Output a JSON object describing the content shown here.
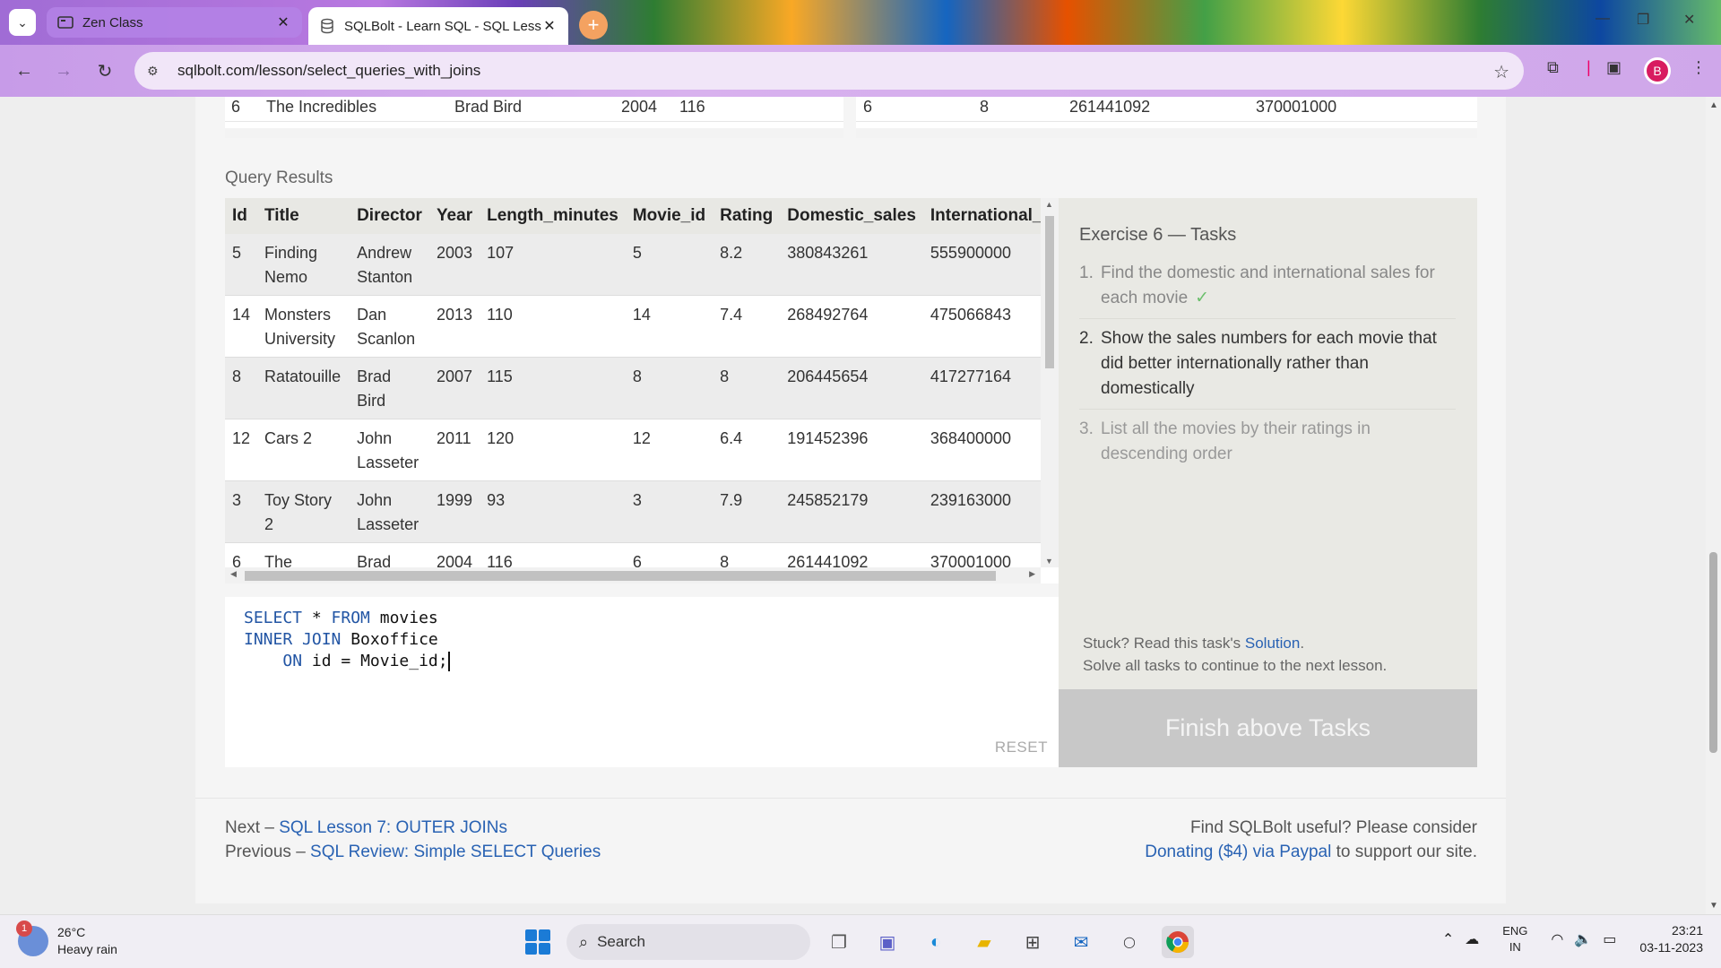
{
  "browser": {
    "tabs": [
      {
        "title": "Zen Class",
        "icon": "zen-class-icon"
      },
      {
        "title": "SQLBolt - Learn SQL - SQL Less",
        "icon": "database-icon"
      }
    ],
    "url": "sqlbolt.com/lesson/select_queries_with_joins",
    "profile_initial": "B",
    "accent": "#b57ee6"
  },
  "partial_tables": {
    "movies_row": [
      "6",
      "The Incredibles",
      "Brad Bird",
      "2004",
      "116"
    ],
    "boxoffice_row": [
      "6",
      "8",
      "261441092",
      "370001000"
    ]
  },
  "query_results": {
    "label": "Query Results",
    "columns": [
      "Id",
      "Title",
      "Director",
      "Year",
      "Length_minutes",
      "Movie_id",
      "Rating",
      "Domestic_sales",
      "International_sa"
    ],
    "rows": [
      [
        "5",
        "Finding Nemo",
        "Andrew Stanton",
        "2003",
        "107",
        "5",
        "8.2",
        "380843261",
        "555900000"
      ],
      [
        "14",
        "Monsters University",
        "Dan Scanlon",
        "2013",
        "110",
        "14",
        "7.4",
        "268492764",
        "475066843"
      ],
      [
        "8",
        "Ratatouille",
        "Brad Bird",
        "2007",
        "115",
        "8",
        "8",
        "206445654",
        "417277164"
      ],
      [
        "12",
        "Cars 2",
        "John Lasseter",
        "2011",
        "120",
        "12",
        "6.4",
        "191452396",
        "368400000"
      ],
      [
        "3",
        "Toy Story 2",
        "John Lasseter",
        "1999",
        "93",
        "3",
        "7.9",
        "245852179",
        "239163000"
      ],
      [
        "6",
        "The Incredibles",
        "Brad Bird",
        "2004",
        "116",
        "6",
        "8",
        "261441092",
        "370001000"
      ]
    ]
  },
  "editor": {
    "line1": {
      "kw1": "SELECT",
      "rest1": " * ",
      "kw2": "FROM",
      "rest2": " movies"
    },
    "line2": {
      "kw1": "INNER JOIN",
      "rest1": " Boxoffice"
    },
    "line3": {
      "indent": "    ",
      "kw1": "ON",
      "rest1": " id = Movie_id;"
    },
    "reset_label": "RESET"
  },
  "tasks": {
    "title": "Exercise 6 — Tasks",
    "items": [
      {
        "num": "1.",
        "text": "Find the domestic and international sales for each movie",
        "state": "done",
        "check": "✓"
      },
      {
        "num": "2.",
        "text": "Show the sales numbers for each movie that did better internationally rather than domestically",
        "state": "active"
      },
      {
        "num": "3.",
        "text": "List all the movies by their ratings in descending order",
        "state": "future"
      }
    ],
    "stuck_prefix": "Stuck? Read this task's ",
    "solution_link": "Solution",
    "stuck_suffix": ".",
    "solve_all": "Solve all tasks to continue to the next lesson.",
    "finish_button": "Finish above Tasks"
  },
  "footer": {
    "next_prefix": "Next – ",
    "next_link": "SQL Lesson 7: OUTER JOINs",
    "prev_prefix": "Previous – ",
    "prev_link": "SQL Review: Simple SELECT Queries",
    "donate_line1": "Find SQLBolt useful? Please consider",
    "donate_link": "Donating ($4) via Paypal",
    "donate_suffix": " to support our site."
  },
  "taskbar": {
    "weather_badge": "1",
    "temperature": "26°C",
    "condition": "Heavy rain",
    "search_placeholder": "Search",
    "lang_top": "ENG",
    "lang_bottom": "IN",
    "time": "23:21",
    "date": "03-11-2023"
  }
}
